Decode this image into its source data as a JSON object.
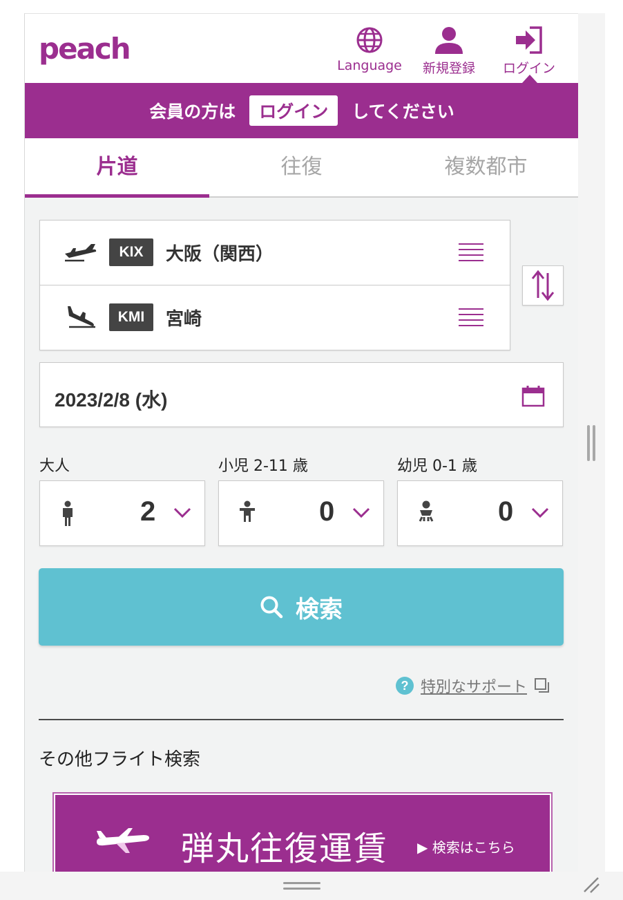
{
  "header": {
    "logo": "peach",
    "nav": [
      {
        "label": "Language",
        "icon": "globe-icon"
      },
      {
        "label": "新規登録",
        "icon": "user-icon"
      },
      {
        "label": "ログイン",
        "icon": "login-icon"
      }
    ]
  },
  "banner": {
    "prefix": "会員の方は",
    "login": "ログイン",
    "suffix": "してください"
  },
  "tabs": [
    {
      "label": "片道",
      "active": true
    },
    {
      "label": "往復",
      "active": false
    },
    {
      "label": "複数都市",
      "active": false
    }
  ],
  "route": {
    "origin": {
      "code": "KIX",
      "city": "大阪（関西）"
    },
    "destination": {
      "code": "KMI",
      "city": "宮崎"
    }
  },
  "date": {
    "value": "2023/2/8 (水)"
  },
  "passengers": [
    {
      "label": "大人",
      "count": "2",
      "icon": "adult-icon"
    },
    {
      "label": "小児  2-11 歳",
      "count": "0",
      "icon": "child-icon"
    },
    {
      "label": "幼児  0-1 歳",
      "count": "0",
      "icon": "infant-icon"
    }
  ],
  "search": {
    "label": "検索"
  },
  "support": {
    "label": "特別なサポート"
  },
  "other": {
    "title": "その他フライト検索"
  },
  "promo": {
    "title": "弾丸往復運賃",
    "link": "▶ 検索はこちら"
  },
  "colors": {
    "brand": "#9b2e8f",
    "search": "#5fc1d1",
    "text": "#333333"
  }
}
